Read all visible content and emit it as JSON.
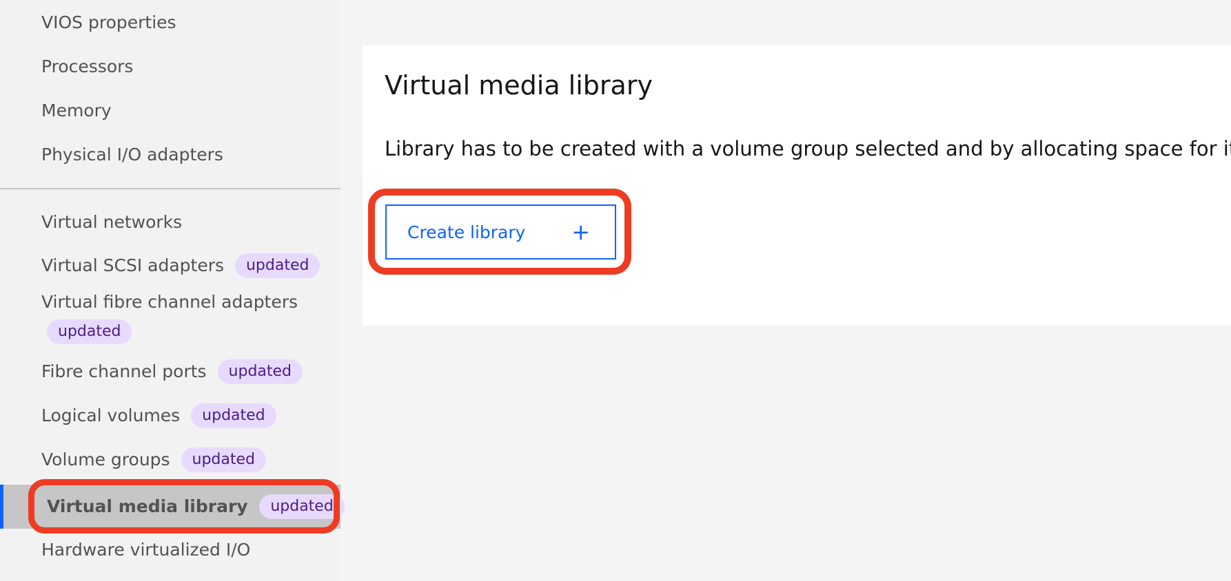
{
  "sidebar": {
    "items": [
      {
        "label": "VIOS properties"
      },
      {
        "label": "Processors"
      },
      {
        "label": "Memory"
      },
      {
        "label": "Physical I/O adapters"
      },
      {
        "label": "Virtual networks"
      },
      {
        "label": "Virtual SCSI adapters",
        "badge": "updated"
      },
      {
        "label": "Virtual fibre channel adapters",
        "badge": "updated"
      },
      {
        "label": "Fibre channel ports",
        "badge": "updated"
      },
      {
        "label": "Logical volumes",
        "badge": "updated"
      },
      {
        "label": "Volume groups",
        "badge": "updated"
      },
      {
        "label": "Virtual media library",
        "badge": "updated",
        "active": true
      },
      {
        "label": "Hardware virtualized I/O"
      }
    ]
  },
  "main": {
    "title": "Virtual media library",
    "description": "Library has to be created with a volume group selected and by allocating space for it",
    "create_button_label": "Create library",
    "create_button_icon": "+"
  },
  "colors": {
    "accent": "#0f62fe",
    "highlight": "#ee3c23",
    "badge_bg": "#e8daff",
    "badge_text": "#491d8b"
  }
}
